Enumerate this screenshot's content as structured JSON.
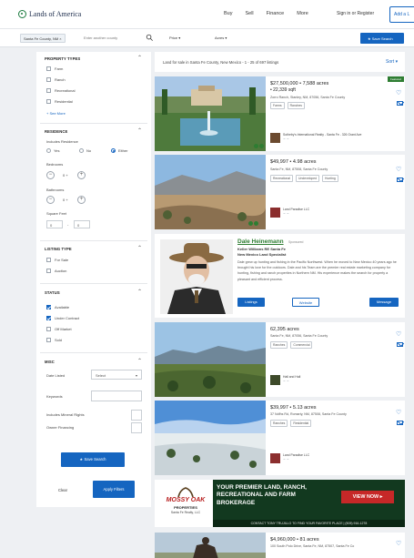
{
  "nav": {
    "logo": "Lands of America",
    "links": [
      "Buy",
      "Sell",
      "Finance",
      "More"
    ],
    "signin": "Sign in or Register",
    "add_listing": "Add a L"
  },
  "searchbar": {
    "location_chip": "Santa Fe County, NM",
    "location_placeholder": "Enter another county",
    "price": "Price",
    "acres": "Acres",
    "save_search": "Save Search"
  },
  "filters": {
    "property_types": {
      "title": "PROPERTY TYPES",
      "items": [
        {
          "label": "Farm",
          "checked": false
        },
        {
          "label": "Ranch",
          "checked": false
        },
        {
          "label": "Recreational",
          "checked": false
        },
        {
          "label": "Residential",
          "checked": false
        }
      ],
      "see_more": "+ See More"
    },
    "residence": {
      "title": "RESIDENCE",
      "includes_label": "Includes Residence",
      "options": [
        "Yes",
        "No",
        "Either"
      ],
      "selected": "Either",
      "bedrooms_label": "Bedrooms",
      "bedrooms_value": "0 +",
      "bathrooms_label": "Bathrooms",
      "bathrooms_value": "0 +",
      "sqft_label": "Square Feet",
      "sqft_min": "0",
      "sqft_sep": "-",
      "sqft_max": "0"
    },
    "listing_type": {
      "title": "LISTING TYPE",
      "items": [
        {
          "label": "For Sale",
          "checked": false
        },
        {
          "label": "Auction",
          "checked": false
        }
      ]
    },
    "status": {
      "title": "STATUS",
      "items": [
        {
          "label": "Available",
          "checked": true
        },
        {
          "label": "Under Contract",
          "checked": true
        },
        {
          "label": "Off Market",
          "checked": false
        },
        {
          "label": "Sold",
          "checked": false
        }
      ]
    },
    "misc": {
      "title": "MISC",
      "date_listed_label": "Date Listed",
      "date_listed_value": "Select",
      "keywords_label": "Keywords",
      "mineral_label": "Includes Mineral Rights",
      "owner_label": "Owner Financing"
    },
    "save_search": "Save Search",
    "clear": "Clear",
    "apply": "Apply Filters"
  },
  "results": {
    "count_text": "Land for sale in Santa Fe County, New Mexico - 1 - 25 of 697 listings",
    "sort_label": "Sort",
    "listings": [
      {
        "price": "$27,500,000 • 7,588 acres",
        "sqft": "• 22,339 sqft",
        "address": "Zorro Ranch, Stanley, NM, 87056, Santa Fe County",
        "tags": [
          "Farms",
          "Ranches"
        ],
        "agent": "Sotheby's International Realty - Santa Fe - 326 Grant Ave",
        "featured": "Featured"
      },
      {
        "price": "$49,997 • 4.98 acres",
        "address": "Santa Fe, NM, 87508, Santa Fe County",
        "tags": [
          "Recreational",
          "Undeveloped",
          "Hunting"
        ],
        "agent": "Land Paradise LLC"
      },
      {
        "price": "62,395 acres",
        "address": "Santa Fe, NM, 87056, Santa Fe County",
        "tags": [
          "Ranches",
          "Commercial"
        ],
        "agent": "Hall and Hall"
      },
      {
        "price": "$39,997 • 5.13 acres",
        "address": "37 Ndfhs Rd, Romarty, NM, 87508, Santa Fe County",
        "tags": [
          "Ranches",
          "Residential"
        ],
        "agent": "Land Paradise LLC"
      },
      {
        "price": "$4,960,000 • 81 acres",
        "address": "100 South Polo Drive, Santa Fe, NM, 87507, Santa Fe Co"
      }
    ],
    "promo": {
      "name": "Dale Heinemann",
      "sponsored": "Sponsored",
      "line1": "Keller Williams RE Santa Fe",
      "line2": "New Mexico Land Specialist",
      "description": "Dale grew up hunting and fishing in the Pacific Northwest. When he moved to New Mexico 40 years ago he brought his love for the outdoors. Dale and his Team are the premier real estate marketing company for hunting, fishing and ranch properties in Northern NM. His experience makes the search for property a pleasant and efficient process.",
      "btn_listings": "Listings",
      "btn_website": "Website",
      "btn_message": "Message"
    },
    "banner": {
      "logo_title": "MOSSY OAK",
      "logo_sub": "PROPERTIES",
      "logo_firm": "Santa Fe Realty, LLC",
      "headline": "YOUR PREMIER LAND, RANCH, RECREATIONAL AND FARM BROKERAGE",
      "cta": "VIEW NOW ▸",
      "footer": "CONTACT TONY TRUJILLO TO FIND YOUR FAVORITE PLACE | (505) 916-1278"
    }
  },
  "colors": {
    "accent": "#1565c0",
    "brand_green": "#2e7d32",
    "banner_green": "#12391f",
    "banner_red": "#c62828"
  }
}
